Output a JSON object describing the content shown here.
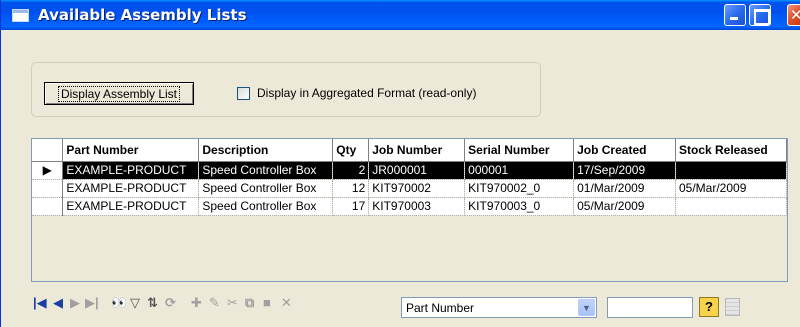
{
  "window": {
    "title": "Available Assembly Lists",
    "controls": {
      "minimize": "minimize",
      "maximize": "maximize",
      "close": "close"
    }
  },
  "filters": {
    "display_button_label": "Display Assembly List",
    "aggregated_checkbox_label": "Display in Aggregated Format (read-only)",
    "aggregated_checked": false
  },
  "grid": {
    "columns": [
      "Part Number",
      "Description",
      "Qty",
      "Job Number",
      "Serial Number",
      "Job Created",
      "Stock Released"
    ],
    "rows": [
      {
        "part_number": "EXAMPLE-PRODUCT",
        "description": "Speed Controller Box",
        "qty": "2",
        "job_number": "JR000001",
        "serial_number": "000001",
        "job_created": "17/Sep/2009",
        "stock_released": "",
        "selected": true
      },
      {
        "part_number": "EXAMPLE-PRODUCT",
        "description": "Speed Controller Box",
        "qty": "12",
        "job_number": "KIT970002",
        "serial_number": "KIT970002_0",
        "job_created": "01/Mar/2009",
        "stock_released": "05/Mar/2009",
        "selected": false
      },
      {
        "part_number": "EXAMPLE-PRODUCT",
        "description": "Speed Controller Box",
        "qty": "17",
        "job_number": "KIT970003",
        "serial_number": "KIT970003_0",
        "job_created": "05/Mar/2009",
        "stock_released": "",
        "selected": false
      }
    ]
  },
  "navigator": {
    "search_field": "Part Number",
    "search_value": "",
    "help_glyph": "?"
  },
  "colors": {
    "title_bar": "#0054e3",
    "window_face": "#ece9d8",
    "selected_row": "#000000"
  }
}
